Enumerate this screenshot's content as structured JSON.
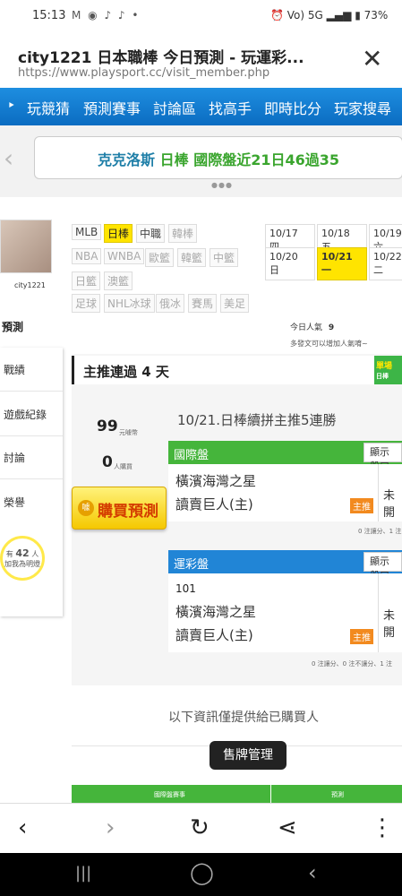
{
  "status_bar": {
    "time": "15:13",
    "left_icons": "M ◉ ♪ ♪ •",
    "network": "Vo) 5G",
    "battery": "73%"
  },
  "browser": {
    "page_title": "city1221 日本職棒 今日預測 - 玩運彩...",
    "url": "https://www.playsport.cc/visit_member.php"
  },
  "nav": [
    "玩競猜",
    "預測賽事",
    "討論區",
    "找高手",
    "即時比分",
    "玩家搜尋"
  ],
  "banner": {
    "prefix": "克克洛斯",
    "league": "日棒",
    "record": "國際盤近21日46過35"
  },
  "profile": {
    "username": "city1221"
  },
  "leagues": {
    "row1": [
      "MLB",
      "日棒",
      "中職",
      "韓棒"
    ],
    "row2": [
      "NBA",
      "WNBA",
      "歐籃",
      "韓籃",
      "中籃"
    ],
    "row3": [
      "日籃",
      "澳籃"
    ],
    "row4": [
      "足球",
      "NHL冰球",
      "俄冰",
      "賽馬",
      "美足"
    ],
    "active": "日棒"
  },
  "dates": [
    [
      "10/17 四",
      "10/18 五",
      "10/19 六"
    ],
    [
      "10/20 日",
      "10/21 一",
      "10/22 二"
    ]
  ],
  "active_date": "10/21 一",
  "side_menu": {
    "predict_tab": "預測",
    "items": [
      "戰績",
      "遊戲紀錄",
      "討論",
      "榮譽"
    ],
    "helpers_prefix": "有",
    "helpers_count": "42",
    "helpers_suffix": "人",
    "helpers_text": "加我為明燈"
  },
  "popularity": {
    "label": "今日人氣",
    "value": "9"
  },
  "hint": "多發文可以增加人氣唷~",
  "main": {
    "title": "主推連過 4 天",
    "badge": "單場",
    "badge_sub": "日棒",
    "price": "99",
    "price_unit": "元噱幣",
    "buyers": "0",
    "buyers_unit": "人購買",
    "buy_button": "購買預測",
    "coin": "噱",
    "event_title": "10/21.日棒續拼主推5連勝"
  },
  "cards": [
    {
      "header": "國際盤",
      "show_button": "顯示盤口",
      "game_no": "",
      "away": "橫濱海灣之星",
      "home": "讀賣巨人(主)",
      "home_badge": "主推",
      "status": "未開",
      "stats": "0 注讓分、1 注"
    },
    {
      "header": "運彩盤",
      "show_button": "顯示盤口",
      "game_no": "101",
      "away": "橫濱海灣之星",
      "home": "讀賣巨人(主)",
      "home_badge": "主推",
      "status": "未開",
      "stats": "0 注讓分、0 注不讓分、1 注"
    }
  ],
  "info_note": "以下資訊僅提供給已購買人",
  "sell_button": "售牌管理",
  "table_head": {
    "col1": "國際盤賽事",
    "col2": "預測"
  },
  "browser_nav": {
    "back": "‹",
    "forward": "›",
    "reload": "↻",
    "share": "⋖",
    "more": "⋮"
  },
  "system_nav": {
    "recent": "|||",
    "home": "◯",
    "back": "‹"
  }
}
